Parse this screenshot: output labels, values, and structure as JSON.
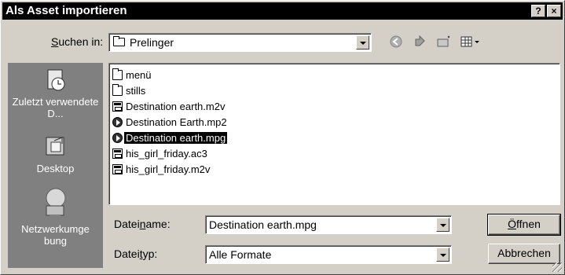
{
  "window": {
    "title": "Als Asset importieren",
    "help_btn": "?",
    "close_btn": "×"
  },
  "look_in": {
    "label_pre": "",
    "label_u": "S",
    "label_post": "uchen in:",
    "value": "Prelinger"
  },
  "places": [
    {
      "label": "Zuletzt verwendete D...",
      "icon": "recent-icon"
    },
    {
      "label": "Desktop",
      "icon": "desktop-icon"
    },
    {
      "label": "Netzwerkumge bung",
      "icon": "network-icon"
    }
  ],
  "files": [
    {
      "name": "menü",
      "icon": "folder-icon",
      "selected": false
    },
    {
      "name": "stills",
      "icon": "folder-icon",
      "selected": false
    },
    {
      "name": "Destination earth.m2v",
      "icon": "video-file-icon",
      "selected": false
    },
    {
      "name": "Destination Earth.mp2",
      "icon": "audio-file-icon",
      "selected": false
    },
    {
      "name": "Destination earth.mpg",
      "icon": "media-file-icon",
      "selected": true
    },
    {
      "name": "his_girl_friday.ac3",
      "icon": "video-file-icon",
      "selected": false
    },
    {
      "name": "his_girl_friday.m2v",
      "icon": "video-file-icon",
      "selected": false
    }
  ],
  "filename": {
    "label_pre": "Datei",
    "label_u": "n",
    "label_post": "ame:",
    "value": "Destination earth.mpg"
  },
  "filetype": {
    "label_pre": "Datei",
    "label_u": "t",
    "label_post": "yp:",
    "value": "Alle Formate"
  },
  "buttons": {
    "open_u": "Ö",
    "open_rest": "ffnen",
    "cancel": "Abbrechen"
  }
}
